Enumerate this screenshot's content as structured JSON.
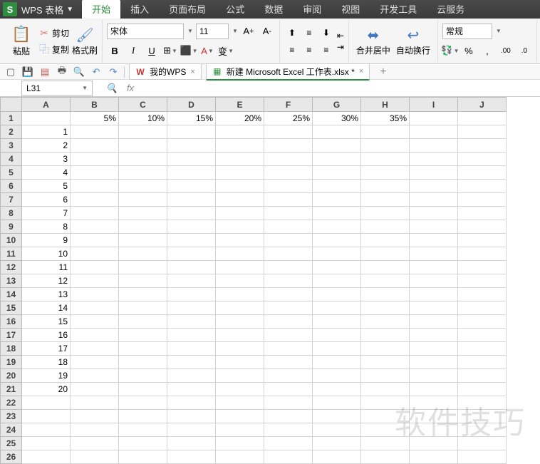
{
  "app": {
    "name": "WPS 表格"
  },
  "menu": {
    "tabs": [
      "开始",
      "插入",
      "页面布局",
      "公式",
      "数据",
      "审阅",
      "视图",
      "开发工具",
      "云服务"
    ],
    "active": 0
  },
  "ribbon": {
    "paste": "粘贴",
    "cut": "剪切",
    "copy": "复制",
    "format_painter": "格式刷",
    "font_name": "宋体",
    "font_size": "11",
    "merge_center": "合并居中",
    "wrap_text": "自动换行",
    "number_format": "常规"
  },
  "doc_tabs": [
    {
      "label": "我的WPS",
      "icon_color": "#c83232"
    },
    {
      "label": "新建 Microsoft Excel 工作表.xlsx *",
      "icon_color": "#2d8e3e"
    }
  ],
  "name_box": "L31",
  "columns": [
    "A",
    "B",
    "C",
    "D",
    "E",
    "F",
    "G",
    "H",
    "I",
    "J"
  ],
  "row_count": 26,
  "cells": {
    "r1": {
      "B": "5%",
      "C": "10%",
      "D": "15%",
      "E": "20%",
      "F": "25%",
      "G": "30%",
      "H": "35%"
    },
    "colA": [
      "1",
      "2",
      "3",
      "4",
      "5",
      "6",
      "7",
      "8",
      "9",
      "10",
      "11",
      "12",
      "13",
      "14",
      "15",
      "16",
      "17",
      "18",
      "19",
      "20"
    ]
  },
  "watermark": "软件技巧"
}
